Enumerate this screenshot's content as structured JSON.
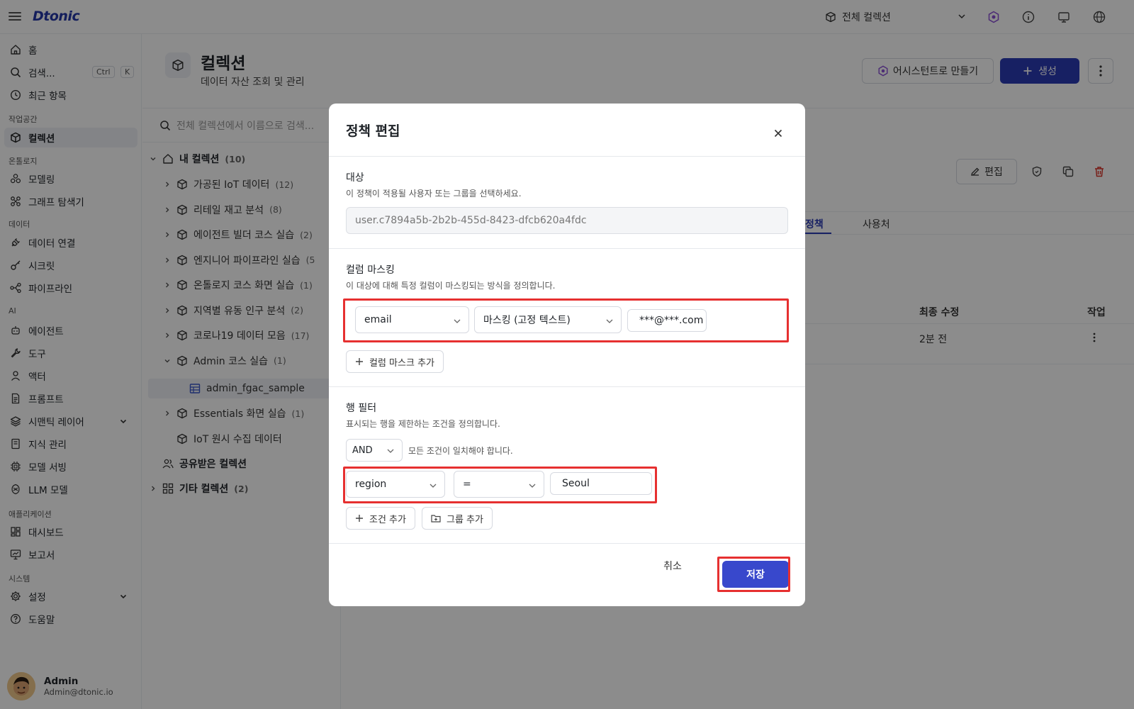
{
  "topbar": {
    "logo": "Dtonic",
    "scope_label": "전체 컬렉션"
  },
  "sidebar": {
    "home": "홈",
    "search": "검색...",
    "search_kbd": [
      "Ctrl",
      "K"
    ],
    "recent": "최근 항목",
    "sections": {
      "workspace": "작업공간",
      "ontology": "온톨로지",
      "data": "데이터",
      "ai": "AI",
      "apps": "애플리케이션",
      "system": "시스템"
    },
    "collections": "컬렉션",
    "modeling": "모델링",
    "graph": "그래프 탐색기",
    "data_conn": "데이터 연결",
    "secret": "시크릿",
    "pipeline": "파이프라인",
    "agent": "에이전트",
    "tool": "도구",
    "actor": "액터",
    "prompt": "프롬프트",
    "semantic": "시맨틱 레이어",
    "knowledge": "지식 관리",
    "model_serving": "모델 서빙",
    "llm": "LLM 모델",
    "dashboard": "대시보드",
    "report": "보고서",
    "settings": "설정",
    "help": "도움말"
  },
  "user": {
    "name": "Admin",
    "email": "Admin@dtonic.io"
  },
  "page": {
    "title": "컬렉션",
    "subtitle": "데이터 자산 조회 및 관리",
    "assistant_btn": "어시스턴트로 만들기",
    "create_btn": "생성"
  },
  "tree": {
    "search_placeholder": "전체 컬렉션에서 이름으로 검색...",
    "my_collections": "내 컬렉션",
    "my_count": "(10)",
    "items": [
      {
        "label": "가공된 IoT 데이터",
        "count": "(12)"
      },
      {
        "label": "리테일 재고 분석",
        "count": "(8)"
      },
      {
        "label": "에이전트 빌더 코스 실습",
        "count": "(2)"
      },
      {
        "label": "엔지니어 파이프라인 실습",
        "count": "(5"
      },
      {
        "label": "온톨로지 코스 화면 실습",
        "count": "(1)"
      },
      {
        "label": "지역별 유동 인구 분석",
        "count": "(2)"
      },
      {
        "label": "코로나19 데이터 모음",
        "count": "(17)"
      },
      {
        "label": "Admin 코스 실습",
        "count": "(1)"
      }
    ],
    "selected_table": "admin_fgac_sample",
    "after_items": [
      {
        "label": "Essentials 화면 실습",
        "count": "(1)"
      },
      {
        "label": "IoT 원시 수집 데이터",
        "count": ""
      }
    ],
    "shared": "공유받은 컬렉션",
    "other": "기타 컬렉션",
    "other_count": "(2)"
  },
  "detail": {
    "edit_btn": "편집",
    "tabs": [
      "정책",
      "사용처"
    ],
    "col_last_modified": "최종 수정",
    "col_action": "작업",
    "row_time": "2분 전"
  },
  "modal": {
    "title": "정책 편집",
    "target": {
      "title": "대상",
      "desc": "이 정책이 적용될 사용자 또는 그룹을 선택하세요.",
      "value": "user.c7894a5b-2b2b-455d-8423-dfcb620a4fdc"
    },
    "masking": {
      "title": "컬럼 마스킹",
      "desc": "이 대상에 대해 특정 컬럼이 마스킹되는 방식을 정의합니다.",
      "column": "email",
      "method": "마스킹 (고정 텍스트)",
      "mask_value": "***@***.com",
      "add_btn": "컬럼 마스크 추가"
    },
    "row_filter": {
      "title": "행 필터",
      "desc": "표시되는 행을 제한하는 조건을 정의합니다.",
      "logic": "AND",
      "logic_desc": "모든 조건이 일치해야 합니다.",
      "column": "region",
      "operator": "=",
      "value": "Seoul",
      "add_condition": "조건 추가",
      "add_group": "그룹 추가"
    },
    "cancel": "취소",
    "save": "저장"
  },
  "colors": {
    "primary": "#2b3bb5",
    "save": "#3848cc",
    "highlight": "#e63030",
    "delete": "#d93025"
  }
}
